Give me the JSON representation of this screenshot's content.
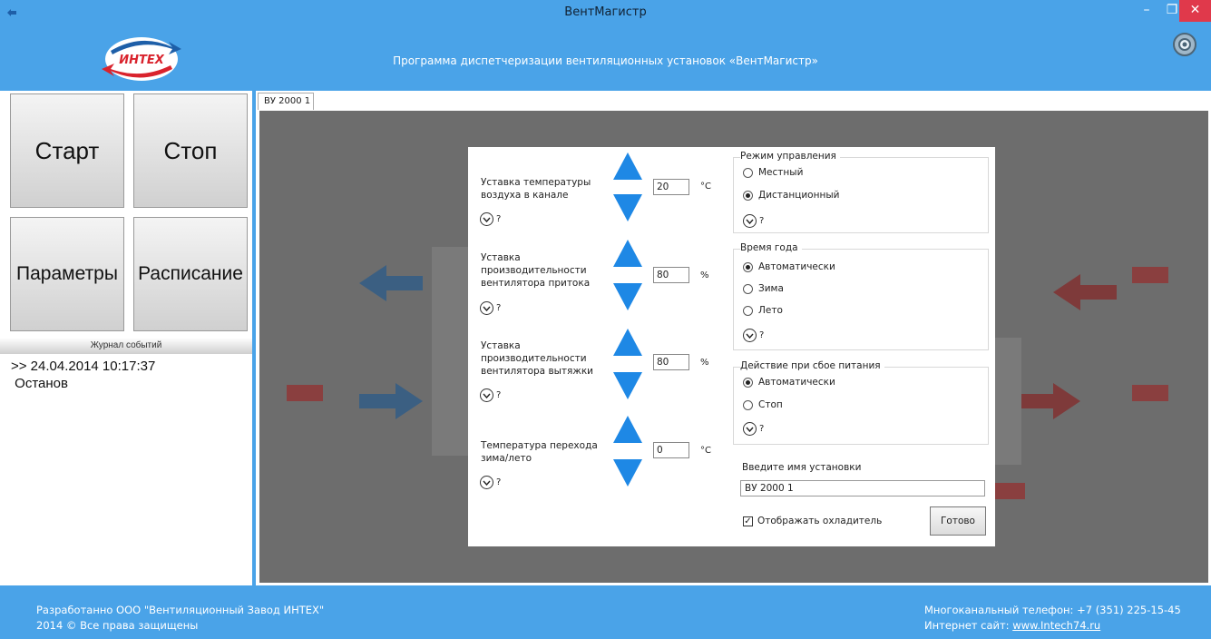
{
  "window": {
    "title": "ВентМагистр",
    "min_label": "–",
    "max_label": "❐",
    "close_label": "✕"
  },
  "header": {
    "logo_text": "ИНТЕХ",
    "subtitle": "Программа диспетчеризации вентиляционных установок «ВентМагистр»"
  },
  "left": {
    "start": "Старт",
    "stop": "Стоп",
    "params": "Параметры",
    "schedule": "Расписание",
    "journal_title": "Журнал событий",
    "journal_entry_time": ">> 24.04.2014 10:17:37",
    "journal_entry_text": " Останов"
  },
  "tab": {
    "label": "ВУ 2000 1"
  },
  "dialog": {
    "help_mark": "?",
    "temp_setpoint": {
      "label": "Уставка температуры воздуха в канале",
      "value": "20",
      "unit": "°C"
    },
    "supply_fan": {
      "label": "Уставка производительности вентилятора притока",
      "value": "80",
      "unit": "%"
    },
    "exhaust_fan": {
      "label": "Уставка производительности вентилятора вытяжки",
      "value": "80",
      "unit": "%"
    },
    "season_temp": {
      "label": "Температура перехода зима/лето",
      "value": "0",
      "unit": "°C"
    },
    "control_mode": {
      "title": "Режим управления",
      "options": [
        "Местный",
        "Дистанционный"
      ],
      "selected": 1
    },
    "season": {
      "title": "Время года",
      "options": [
        "Автоматически",
        "Зима",
        "Лето"
      ],
      "selected": 0
    },
    "power_fail": {
      "title": "Действие при сбое питания",
      "options": [
        "Автоматически",
        "Стоп"
      ],
      "selected": 0
    },
    "name_label": "Введите имя установки",
    "name_value": "ВУ 2000 1",
    "show_cooler": "Отображать охладитель",
    "show_cooler_checked": true,
    "ok": "Готово"
  },
  "footer": {
    "left_line1": "Разработанно ООО \"Вентиляционный Завод ИНТЕХ\"",
    "left_line2": "2014 © Все права защищены",
    "right_line1": "Многоканальный телефон: +7 (351) 225-15-45",
    "right_line2_prefix": "Интернет сайт: ",
    "right_link": "www.Intech74.ru"
  },
  "colors": {
    "brand_blue": "#4aa3e8",
    "arrow_blue": "#1e88e5",
    "close_red": "#e0394b"
  }
}
